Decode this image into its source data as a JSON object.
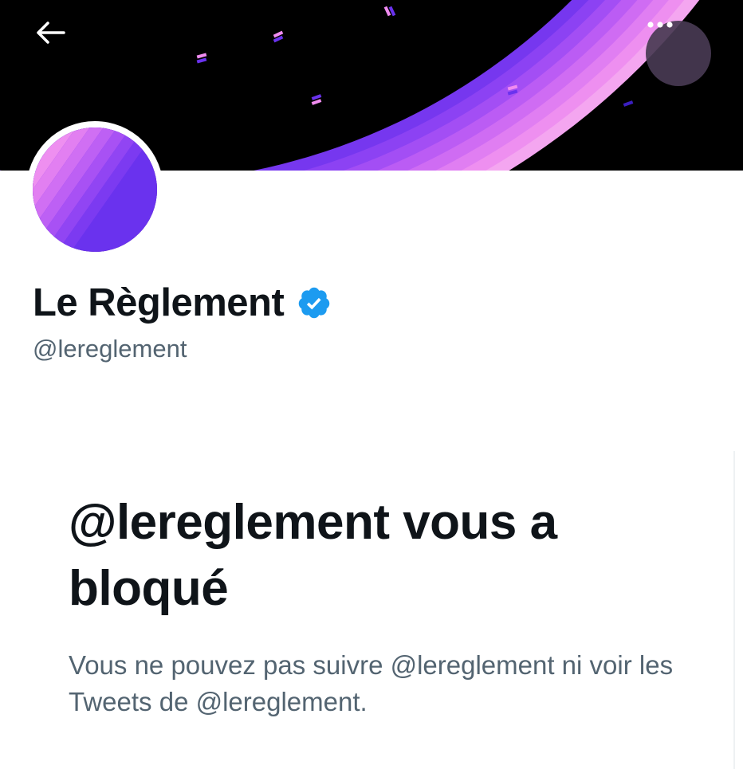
{
  "header": {
    "back_icon": "arrow-left-icon",
    "more_icon": "more-horizontal-icon"
  },
  "profile": {
    "display_name": "Le Règlement",
    "verified_icon": "verified-badge-icon",
    "handle": "@lereglement"
  },
  "blocked": {
    "title": "@lereglement vous a bloqué",
    "description": "Vous ne pouvez pas suivre @lereglement ni voir les Tweets de @lereglement."
  },
  "colors": {
    "banner_bg": "#000000",
    "accent_purple": "#6a32ee",
    "accent_pink": "#f08cf0",
    "verified_blue": "#1d9bf0",
    "text_primary": "#0f1419",
    "text_secondary": "#536471"
  }
}
